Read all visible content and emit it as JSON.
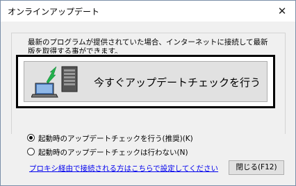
{
  "window": {
    "title": "オンラインアップデート",
    "close_glyph": "✕"
  },
  "main": {
    "description": "最新のプログラムが提供されていた場合、インターネットに接続して最新版を取得する事ができます。",
    "check_button_label": "今すぐアップデートチェックを行う",
    "options": [
      {
        "label": "起動時のアップデートチェックを行う(推奨)(K)",
        "selected": true
      },
      {
        "label": "起動時のアップデートチェックは行わない(N)",
        "selected": false
      }
    ],
    "proxy_link": "プロキシ経由で接続される方はこちらで設定してください",
    "close_button_label": "閉じる(F12)"
  },
  "colors": {
    "window_bg": "#f0f0f0",
    "button_bg": "#e1e1e1",
    "link": "#0000ee",
    "arrow_green": "#22b14c"
  },
  "icons": [
    "laptop-icon",
    "server-icon",
    "arrow-icon"
  ]
}
